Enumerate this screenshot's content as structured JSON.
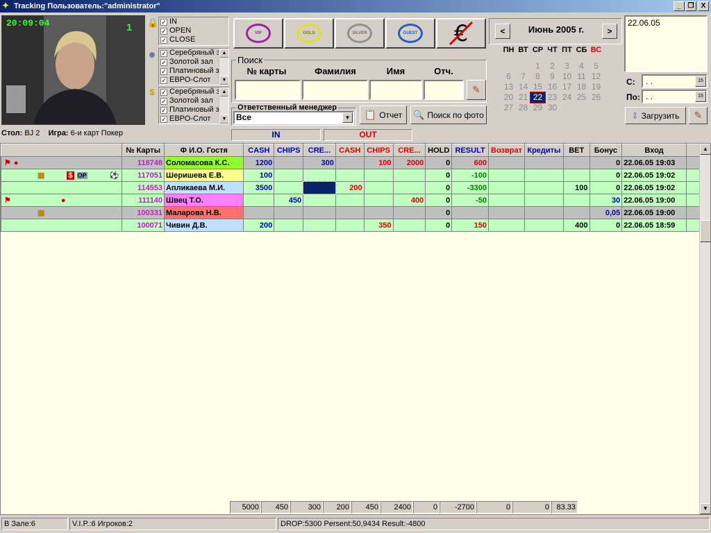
{
  "window": {
    "title": "Tracking Пользователь:\"administrator\"",
    "min_label": "_",
    "restore_label": "❐",
    "close_label": "X"
  },
  "camera": {
    "time": "20:09:04",
    "number": "1"
  },
  "filters": {
    "state": [
      "IN",
      "OPEN",
      "CLOSE"
    ],
    "halls_a": [
      "Серебряный з",
      "Золотой зал",
      "Платиновый з",
      "ЕВРО-Слот"
    ],
    "halls_b": [
      "Серебряный з",
      "Золотой зал",
      "Платиновый з",
      "ЕВРО-Слот"
    ]
  },
  "levels": [
    {
      "label": "VIP",
      "color": "#a020a0"
    },
    {
      "label": "GOLD",
      "color": "#e0e020"
    },
    {
      "label": "SILVER",
      "color": "#909090"
    },
    {
      "label": "GUEST",
      "color": "#2060c0"
    }
  ],
  "search": {
    "title": "Поиск",
    "card_label": "№ карты",
    "surname_label": "Фамилия",
    "name_label": "Имя",
    "patronymic_label": "Отч."
  },
  "manager": {
    "title": "Ответственный менеджер",
    "value": "Все",
    "report_label": "Отчет",
    "photo_search_label": "Поиск по фото"
  },
  "calendar": {
    "month": "Июнь 2005 г.",
    "dow": [
      "ПН",
      "ВТ",
      "СР",
      "ЧТ",
      "ПТ",
      "СБ",
      "ВС"
    ],
    "weeks": [
      [
        "",
        "",
        "",
        "1",
        "2",
        "3",
        "4",
        "5"
      ],
      [
        "6",
        "7",
        "8",
        "9",
        "10",
        "11",
        "12"
      ],
      [
        "13",
        "14",
        "15",
        "16",
        "17",
        "18",
        "19"
      ],
      [
        "20",
        "21",
        "22",
        "23",
        "24",
        "25",
        "26"
      ],
      [
        "27",
        "28",
        "29",
        "30",
        "",
        "",
        ""
      ]
    ],
    "selected": "22"
  },
  "notes": {
    "date": "22.06.05"
  },
  "range": {
    "from_label": "С:",
    "to_label": "По:",
    "from_value": " .  .",
    "to_value": " .  .",
    "load_label": "Загрузить"
  },
  "info": {
    "table_label": "Стол:",
    "table_value": "BJ 2",
    "game_label": "Игра:",
    "game_value": "6-и карт Покер"
  },
  "section_labels": {
    "in": "IN",
    "out": "OUT"
  },
  "grid": {
    "columns": [
      "",
      "№ Карты",
      "Ф И.О. Гостя",
      "CASH",
      "CHIPS",
      "CRE...",
      "CASH",
      "CHIPS",
      "CRE...",
      "HOLD",
      "RESULT",
      "Возврат",
      "Кредиты",
      "BET",
      "Бонус",
      "Вход"
    ],
    "rows": [
      {
        "card": "118748",
        "name": "Соломасова К.С.",
        "in_cash": "1200",
        "in_chips": "",
        "in_cre": "300",
        "out_cash": "",
        "out_chips": "100",
        "out_cre": "2000",
        "hold": "0",
        "result": "600",
        "ret": "",
        "cred": "",
        "bet": "",
        "bonus": "0",
        "entry": "22.06.05 19:03"
      },
      {
        "card": "117051",
        "name": "Шеришева Е.В.",
        "in_cash": "100",
        "in_chips": "",
        "in_cre": "",
        "out_cash": "",
        "out_chips": "",
        "out_cre": "",
        "hold": "0",
        "result": "-100",
        "ret": "",
        "cred": "",
        "bet": "",
        "bonus": "0",
        "entry": "22.06.05 19:02"
      },
      {
        "card": "114553",
        "name": "Апликаева М.И.",
        "in_cash": "3500",
        "in_chips": "",
        "in_cre": "",
        "out_cash": "200",
        "out_chips": "",
        "out_cre": "",
        "hold": "0",
        "result": "-3300",
        "ret": "",
        "cred": "",
        "bet": "100",
        "bonus": "0",
        "entry": "22.06.05 19:02"
      },
      {
        "card": "111140",
        "name": "Швец Т.О.",
        "in_cash": "",
        "in_chips": "450",
        "in_cre": "",
        "out_cash": "",
        "out_chips": "",
        "out_cre": "400",
        "hold": "0",
        "result": "-50",
        "ret": "",
        "cred": "",
        "bet": "",
        "bonus": "30",
        "entry": "22.06.05 19:00"
      },
      {
        "card": "100331",
        "name": "Маларова Н.В.",
        "in_cash": "",
        "in_chips": "",
        "in_cre": "",
        "out_cash": "",
        "out_chips": "",
        "out_cre": "",
        "hold": "0",
        "result": "",
        "ret": "",
        "cred": "",
        "bet": "",
        "bonus": "0,05",
        "entry": "22.06.05 19:00"
      },
      {
        "card": "100071",
        "name": "Чивин Д.В.",
        "in_cash": "200",
        "in_chips": "",
        "in_cre": "",
        "out_cash": "",
        "out_chips": "350",
        "out_cre": "",
        "hold": "0",
        "result": "150",
        "ret": "",
        "cred": "",
        "bet": "400",
        "bonus": "0",
        "entry": "22.06.05 18:59"
      }
    ],
    "op_badge": "OP",
    "totals": [
      "5000",
      "450",
      "300",
      "200",
      "450",
      "2400",
      "0",
      "-2700",
      "0",
      "0",
      "83.33"
    ]
  },
  "status": {
    "in_hall": "В Зале:6",
    "vip": "V.I.P.:6 Игроков:2",
    "summary": "DROP:5300  Persent:50,9434  Result:-4800"
  },
  "colors": {
    "title_start": "#0a246a",
    "grid_bg": "#ffffe7",
    "row_green": "#c0ffc0",
    "row_gray": "#c0c0c0"
  }
}
